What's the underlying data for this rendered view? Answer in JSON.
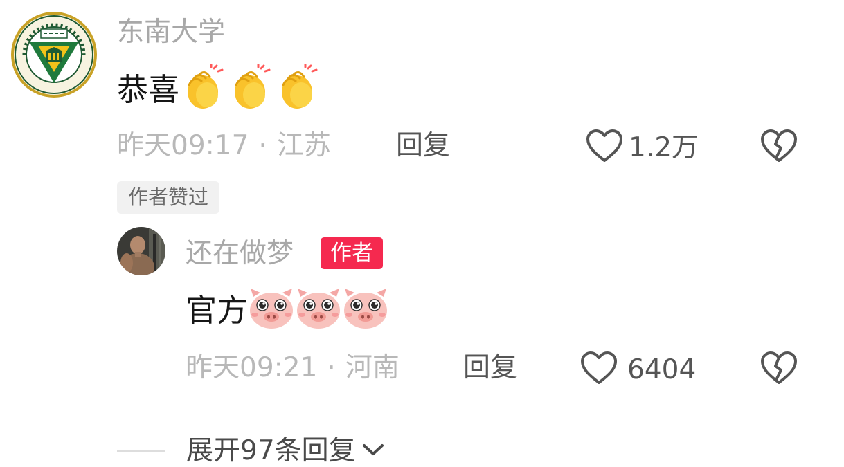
{
  "comment": {
    "author": "东南大学",
    "avatar_icon": "southeast-university-seal-icon",
    "text": "恭喜",
    "emoji_icon": "clapping-hands-emoji-icon",
    "emoji_count": 3,
    "time": "昨天09:17",
    "separator": "·",
    "location": "江苏",
    "reply_label": "回复",
    "like_count": "1.2万",
    "liked_by_author_label": "作者赞过"
  },
  "reply": {
    "author": "还在做梦",
    "author_badge": "作者",
    "text": "官方",
    "emoji_icon": "pig-face-emoji-icon",
    "emoji_count": 3,
    "time": "昨天09:21",
    "separator": "·",
    "location": "河南",
    "reply_label": "回复",
    "like_count": "6404"
  },
  "expand": {
    "label": "展开97条回复"
  },
  "colors": {
    "author_badge_bg": "#f5294f",
    "seal_green": "#1f7a3c",
    "seal_gold": "#f2c21a"
  }
}
